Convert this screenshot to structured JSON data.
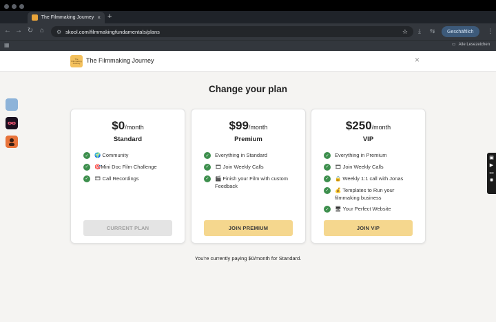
{
  "browser": {
    "tab_title": "The Filmmaking Journey",
    "tab_close": "×",
    "new_tab": "+",
    "url": "skool.com/filmmakingfundamentals/plans",
    "profile_label": "Geschäftlich",
    "bookmarks_all": "Alle Lesezeichen",
    "icons": {
      "back": "←",
      "forward": "→",
      "reload": "↻",
      "home": "⌂",
      "site_info": "⚙",
      "star": "☆",
      "download": "⤓",
      "cast": "⇆",
      "menu": "⋮",
      "apps": "▦",
      "folder": "▭"
    }
  },
  "header": {
    "logo_text": "The Filmmaking Journey",
    "brand": "The Filmmaking Journey",
    "close": "×"
  },
  "main": {
    "title": "Change your plan",
    "plans": [
      {
        "price": "$0",
        "period": "/month",
        "name": "Standard",
        "features": [
          "🌍 Community",
          "🎯Mini Doc Film Challenge",
          "🎞 Call Recordings"
        ],
        "cta": "CURRENT PLAN"
      },
      {
        "price": "$99",
        "period": "/month",
        "name": "Premium",
        "features": [
          "Everything in Standard",
          "🎞 Join Weekly Calls",
          "🎬 Finish your Film with custom Feedback"
        ],
        "cta": "JOIN PREMIUM"
      },
      {
        "price": "$250",
        "period": "/month",
        "name": "VIP",
        "features": [
          "Everything in Premium",
          "🎞 Join Weekly Calls",
          "🔒 Weekly 1:1 call with Jonas",
          "💰 Templates to Run your filmmaking business",
          "🖥 Your Perfect Website"
        ],
        "cta": "JOIN VIP"
      }
    ],
    "check": "✓",
    "footer": "You're currently paying $0/month for Standard."
  },
  "colors": {
    "accent_button": "#f5d78e",
    "check_green": "#3d8f4d",
    "current_button": "#e4e4e4"
  }
}
